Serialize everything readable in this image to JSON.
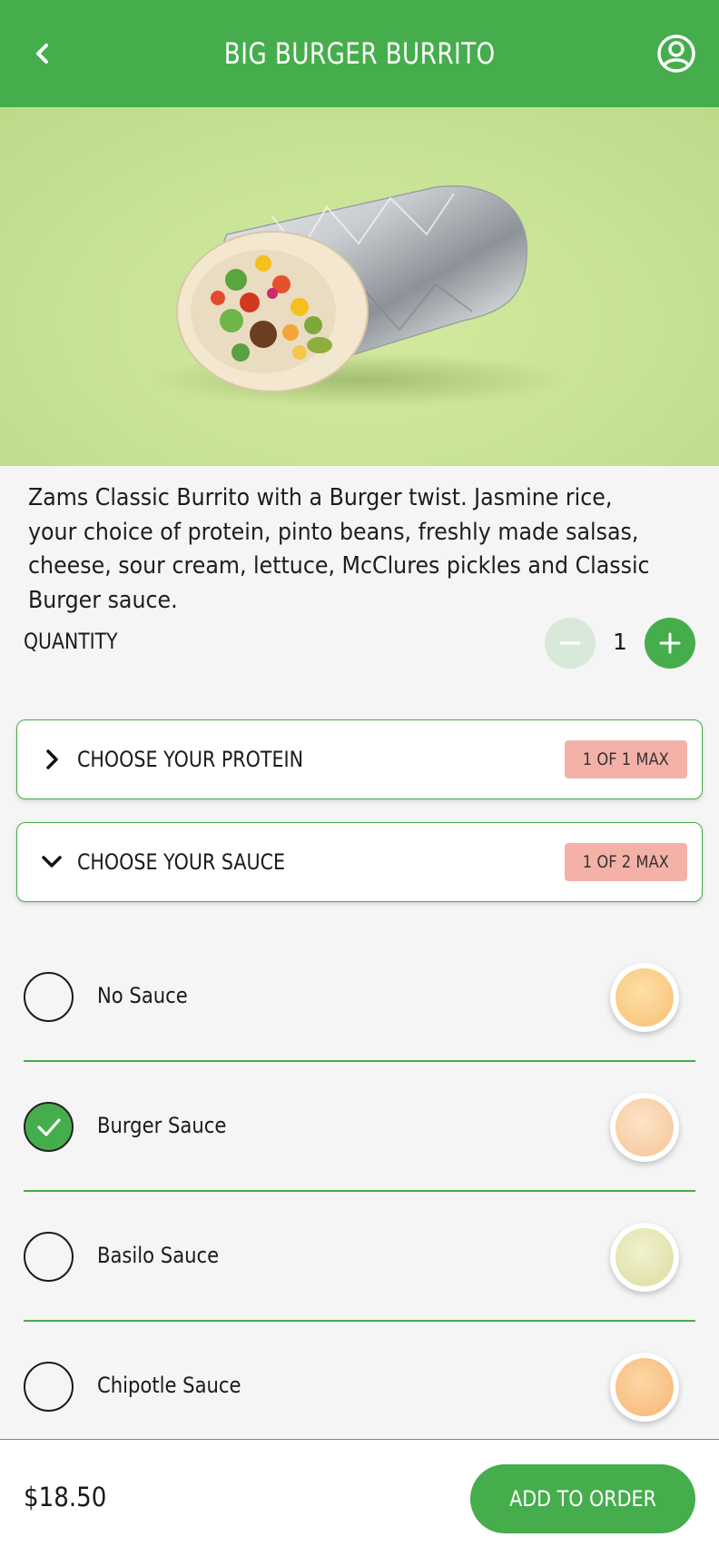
{
  "header": {
    "title": "BIG BURGER BURRITO",
    "back_icon": "chevron-left-icon",
    "profile_icon": "user-circle-icon"
  },
  "hero": {
    "image": "burrito-photo"
  },
  "description": "Zams Classic Burrito with a Burger twist. Jasmine rice, your choice of protein, pinto beans, freshly made salsas, cheese, sour cream, lettuce, McClures pickles and Classic Burger sauce.",
  "quantity": {
    "label": "QUANTITY",
    "value": "1"
  },
  "sections": [
    {
      "title": "CHOOSE YOUR PROTEIN",
      "badge": "1 OF 1 MAX",
      "expanded": false
    },
    {
      "title": "CHOOSE YOUR SAUCE",
      "badge": "1 OF 2 MAX",
      "expanded": true
    }
  ],
  "sauces": [
    {
      "name": "No Sauce",
      "checked": false,
      "color": "#f9c77e"
    },
    {
      "name": "Burger Sauce",
      "checked": true,
      "color": "#f8cfa4"
    },
    {
      "name": "Basilo Sauce",
      "checked": false,
      "color": "#e4e5b2"
    },
    {
      "name": "Chipotle Sauce",
      "checked": false,
      "color": "#f8c48a"
    }
  ],
  "footer": {
    "price": "$18.50",
    "add_button": "ADD TO ORDER"
  },
  "colors": {
    "brand_green": "#46ad4c",
    "badge_bg": "#f4b1a8",
    "hero_bg": "#c9e496"
  }
}
